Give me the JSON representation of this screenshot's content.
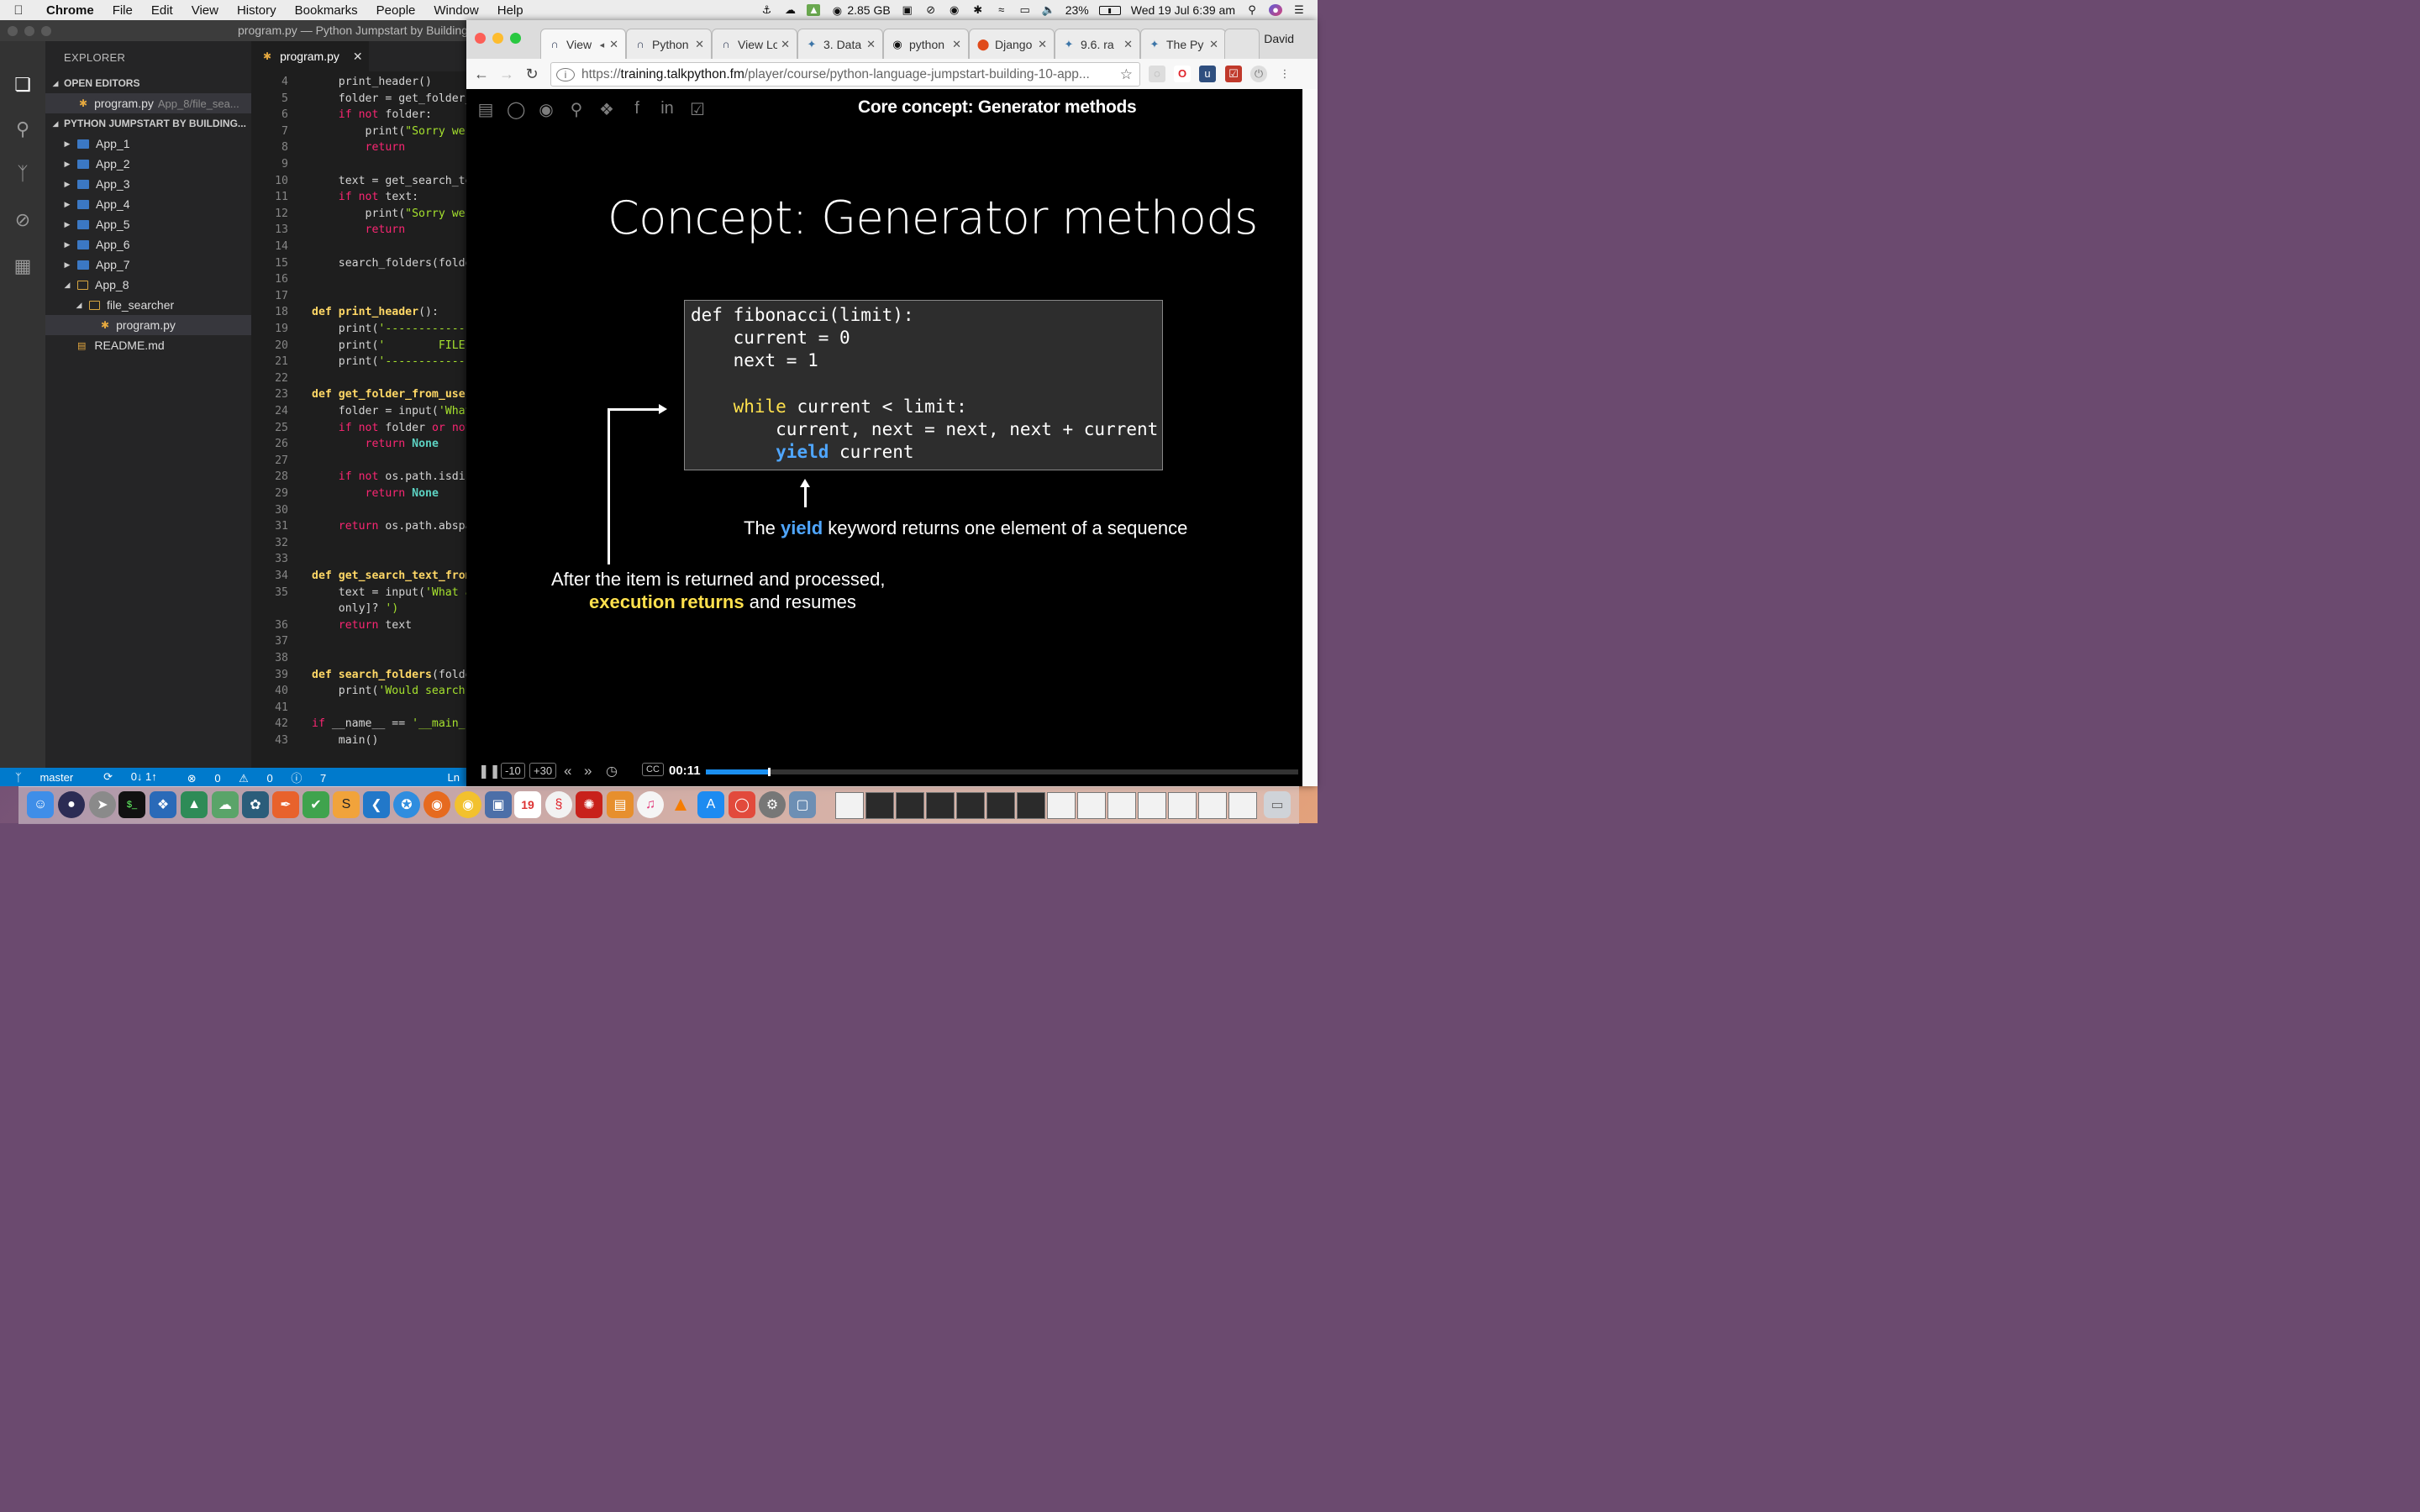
{
  "menubar": {
    "app_name": "Chrome",
    "items": [
      "File",
      "Edit",
      "View",
      "History",
      "Bookmarks",
      "People",
      "Window",
      "Help"
    ],
    "memory": "2.85 GB",
    "battery": "23%",
    "clock": "Wed 19 Jul  6:39 am"
  },
  "vscode": {
    "window_title": "program.py — Python Jumpstart by Building",
    "explorer_title": "EXPLORER",
    "open_editors_label": "OPEN EDITORS",
    "open_editor_file": "program.py",
    "open_editor_path": "App_8/file_sea...",
    "project_label": "PYTHON JUMPSTART BY BUILDING...",
    "folders": [
      "App_1",
      "App_2",
      "App_3",
      "App_4",
      "App_5",
      "App_6",
      "App_7",
      "App_8"
    ],
    "subfolder": "file_searcher",
    "selected_file": "program.py",
    "readme": "README.md",
    "tab_label": "program.py",
    "code_lines": [
      {
        "n": "4",
        "t": "    print_header()"
      },
      {
        "n": "5",
        "t": "    folder = get_folder_"
      },
      {
        "n": "6",
        "t": "    if not folder:"
      },
      {
        "n": "7",
        "t": "        print(\"Sorry we"
      },
      {
        "n": "8",
        "t": "        return"
      },
      {
        "n": "9",
        "t": ""
      },
      {
        "n": "10",
        "t": "    text = get_search_te"
      },
      {
        "n": "11",
        "t": "    if not text:"
      },
      {
        "n": "12",
        "t": "        print(\"Sorry we"
      },
      {
        "n": "13",
        "t": "        return"
      },
      {
        "n": "14",
        "t": ""
      },
      {
        "n": "15",
        "t": "    search_folders(folde"
      },
      {
        "n": "16",
        "t": ""
      },
      {
        "n": "17",
        "t": ""
      },
      {
        "n": "18",
        "t": "def print_header():"
      },
      {
        "n": "19",
        "t": "    print('------------"
      },
      {
        "n": "20",
        "t": "    print('        FILE"
      },
      {
        "n": "21",
        "t": "    print('------------"
      },
      {
        "n": "22",
        "t": ""
      },
      {
        "n": "23",
        "t": "def get_folder_from_user"
      },
      {
        "n": "24",
        "t": "    folder = input('What"
      },
      {
        "n": "25",
        "t": "    if not folder or not"
      },
      {
        "n": "26",
        "t": "        return None"
      },
      {
        "n": "27",
        "t": ""
      },
      {
        "n": "28",
        "t": "    if not os.path.isdi"
      },
      {
        "n": "29",
        "t": "        return None"
      },
      {
        "n": "30",
        "t": ""
      },
      {
        "n": "31",
        "t": "    return os.path.abspa"
      },
      {
        "n": "32",
        "t": ""
      },
      {
        "n": "33",
        "t": ""
      },
      {
        "n": "34",
        "t": "def get_search_text_from"
      },
      {
        "n": "35",
        "t": "    text = input('What a"
      },
      {
        "n": "",
        "t": "    only]? ')"
      },
      {
        "n": "36",
        "t": "    return text"
      },
      {
        "n": "37",
        "t": ""
      },
      {
        "n": "38",
        "t": ""
      },
      {
        "n": "39",
        "t": "def search_folders(folde"
      },
      {
        "n": "40",
        "t": "    print('Would search"
      },
      {
        "n": "41",
        "t": ""
      },
      {
        "n": "42",
        "t": "if __name__ == '__main_"
      },
      {
        "n": "43",
        "t": "    main()"
      }
    ],
    "status": {
      "branch": "master",
      "sync": "0↓ 1↑",
      "errors": "0",
      "warnings": "0",
      "info": "7",
      "position": "Ln"
    }
  },
  "chrome": {
    "tabs": [
      {
        "label": "View",
        "icon": "headphones-icon"
      },
      {
        "label": "Python",
        "icon": "headphones-icon"
      },
      {
        "label": "View Lo",
        "icon": "headphones-icon"
      },
      {
        "label": "3. Data",
        "icon": "python-icon"
      },
      {
        "label": "python",
        "icon": "github-icon"
      },
      {
        "label": "Django",
        "icon": "django-icon"
      },
      {
        "label": "9.6. ra",
        "icon": "python-icon"
      },
      {
        "label": "The Py",
        "icon": "python-icon"
      }
    ],
    "profile": "David",
    "url_prefix": "https://",
    "url_host": "training.talkpython.fm",
    "url_path": "/player/course/python-language-jumpstart-building-10-app..."
  },
  "slide": {
    "header": "Core concept: Generator methods",
    "title": "Concept: Generator methods",
    "code": [
      "def fibonacci(limit):",
      "    current = 0",
      "    next = 1",
      "",
      "    while current < limit:",
      "        current, next = next, next + current",
      "        yield current"
    ],
    "note1_before": "The ",
    "note1_kw": "yield",
    "note1_after": " keyword returns one element of a sequence",
    "note2_line1": "After the item is returned and processed,",
    "note2_kw": "execution returns",
    "note2_after": " and resumes"
  },
  "player": {
    "back_label": "-10",
    "forward_label": "+30",
    "cc_label": "CC",
    "time": "00:11",
    "progress_fraction": 0.106
  },
  "dock": {
    "calendar_day": "19"
  }
}
